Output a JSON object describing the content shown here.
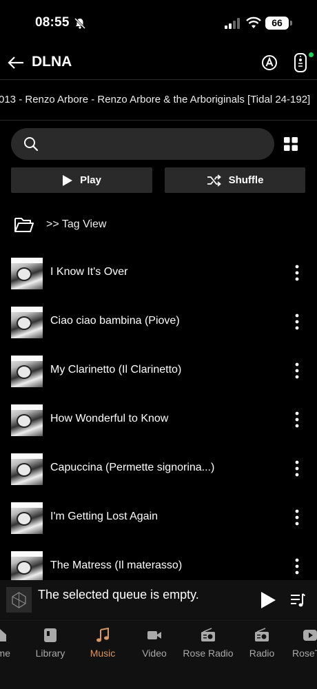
{
  "status": {
    "time": "08:55",
    "battery": "66"
  },
  "header": {
    "title": "DLNA"
  },
  "path": "013 - Renzo Arbore - Renzo Arbore & the Arboriginals [Tidal 24-192]",
  "search": {
    "placeholder": ""
  },
  "actions": {
    "play_label": "Play",
    "shuffle_label": "Shuffle"
  },
  "tag_view": {
    "label": ">> Tag View"
  },
  "tracks": [
    {
      "title": "I Know It's Over"
    },
    {
      "title": "Ciao ciao bambina (Piove)"
    },
    {
      "title": "My Clarinetto (Il Clarinetto)"
    },
    {
      "title": "How Wonderful to Know"
    },
    {
      "title": "Capuccina (Permette signorina...)"
    },
    {
      "title": "I'm Getting Lost Again"
    },
    {
      "title": "The Matress (Il materasso)"
    }
  ],
  "mini_player": {
    "status_text": "The selected queue is empty."
  },
  "nav": {
    "items": [
      {
        "label": "me",
        "icon": "home-icon"
      },
      {
        "label": "Library",
        "icon": "library-icon"
      },
      {
        "label": "Music",
        "icon": "music-note-icon",
        "active": true
      },
      {
        "label": "Video",
        "icon": "video-icon"
      },
      {
        "label": "Rose Radio",
        "icon": "rose-radio-icon"
      },
      {
        "label": "Radio",
        "icon": "radio-icon"
      },
      {
        "label": "RoseT",
        "icon": "rosetube-icon"
      }
    ]
  },
  "colors": {
    "accent": "#d89863",
    "online": "#1fd25a",
    "surface": "#2a2a2a"
  }
}
